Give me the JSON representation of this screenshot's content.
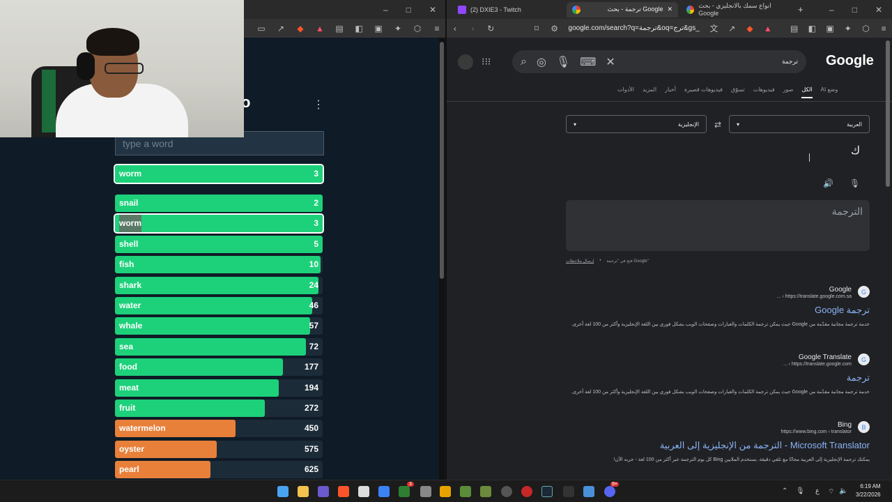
{
  "left_browser": {
    "tab_title": "",
    "win_controls": [
      "–",
      "□",
      "✕"
    ]
  },
  "webcam": {
    "label": "webcam-overlay"
  },
  "game": {
    "logo_fragment": "o",
    "input_placeholder": "type a word",
    "current_guess": {
      "word": "worm",
      "rank": "3",
      "fill": 1.0,
      "color": "#1dd17a"
    },
    "guesses": [
      {
        "word": "snail",
        "rank": "2",
        "fill": 1.0,
        "color": "#1dd17a"
      },
      {
        "word": "worm",
        "rank": "3",
        "fill": 1.0,
        "color": "#1dd17a",
        "outlined": true,
        "highlighted": true
      },
      {
        "word": "shell",
        "rank": "5",
        "fill": 1.0,
        "color": "#1dd17a"
      },
      {
        "word": "fish",
        "rank": "10",
        "fill": 0.99,
        "color": "#1dd17a"
      },
      {
        "word": "shark",
        "rank": "24",
        "fill": 0.98,
        "color": "#1dd17a"
      },
      {
        "word": "water",
        "rank": "46",
        "fill": 0.95,
        "color": "#1dd17a"
      },
      {
        "word": "whale",
        "rank": "57",
        "fill": 0.94,
        "color": "#1dd17a"
      },
      {
        "word": "sea",
        "rank": "72",
        "fill": 0.92,
        "color": "#1dd17a"
      },
      {
        "word": "food",
        "rank": "177",
        "fill": 0.81,
        "color": "#1dd17a"
      },
      {
        "word": "meat",
        "rank": "194",
        "fill": 0.79,
        "color": "#1dd17a"
      },
      {
        "word": "fruit",
        "rank": "272",
        "fill": 0.72,
        "color": "#1dd17a"
      },
      {
        "word": "watermelon",
        "rank": "450",
        "fill": 0.58,
        "color": "#e8803a"
      },
      {
        "word": "oyster",
        "rank": "575",
        "fill": 0.49,
        "color": "#e8803a"
      },
      {
        "word": "pearl",
        "rank": "625",
        "fill": 0.46,
        "color": "#e8803a"
      }
    ]
  },
  "right_browser": {
    "tabs": [
      {
        "title": "(2) DXIE3 - Twitch",
        "icon": "twitch-icon"
      },
      {
        "title": "ترجمة - بحث Google",
        "icon": "google-icon",
        "active": true
      },
      {
        "title": "انواع سمك بالانجليزي - بحث Google",
        "icon": "google-icon"
      }
    ],
    "url": "google.com/search?q=ترجمة&oq=ترج&gs_lcrp=EgZ...",
    "new_tab": "+",
    "win_controls": [
      "–",
      "□",
      "✕"
    ]
  },
  "google": {
    "logo": "Google",
    "query": "ترجمة",
    "tabs": [
      "وضع AI",
      "الكل",
      "صور",
      "فيديوهات",
      "تسوّق",
      "فيديوهات قصيرة",
      "أخبار",
      "المزيد",
      "الأدوات"
    ],
    "selected_tab": "الكل",
    "source_lang": "العربية",
    "target_lang": "الإنجليزية",
    "source_text": "ك",
    "output_placeholder": "الترجمة",
    "footer_open": "فتح في \"ترجمة Google\"",
    "footer_feedback": "إرسال ملاحظات",
    "results": [
      {
        "site": "Google",
        "url": "https://translate.google.com.sa › ...",
        "title": "ترجمة Google",
        "snippet": "خدمة ترجمة مجانية مقدّمة من Google حيث يمكن ترجمة الكلمات والعبارات وصفحات الويب بشكل فوري بين اللغة الإنجليزية وأكثر من 100 لغة أخرى.",
        "icon_glyph": "G"
      },
      {
        "site": "Google Translate",
        "url": "https://translate.google.com › ...",
        "title": "ترجمة",
        "snippet": "خدمة ترجمة مجانية مقدّمة من Google حيث يمكن ترجمة الكلمات والعبارات وصفحات الويب بشكل فوري بين اللغة الإنجليزية وأكثر من 100 لغة أخرى.",
        "icon_glyph": "G"
      },
      {
        "site": "Bing",
        "url": "https://www.bing.com › translator",
        "title": "Microsoft Translator - الترجمة من الإنجليزية إلى العربية",
        "snippet": "يمكنك ترجمة الإنجليزية إلى العربية مجانًا مع تلقي دقيقة. يستخدم الملايين Bing كل يوم الترجمة عبر أكثر من 100 لغة - جربه الآن!",
        "icon_glyph": "B"
      }
    ]
  },
  "taskbar": {
    "time": "6:19 AM",
    "date": "3/22/2026",
    "lang": "ع",
    "badges": {
      "xbox": "3",
      "discord": "9+"
    }
  }
}
